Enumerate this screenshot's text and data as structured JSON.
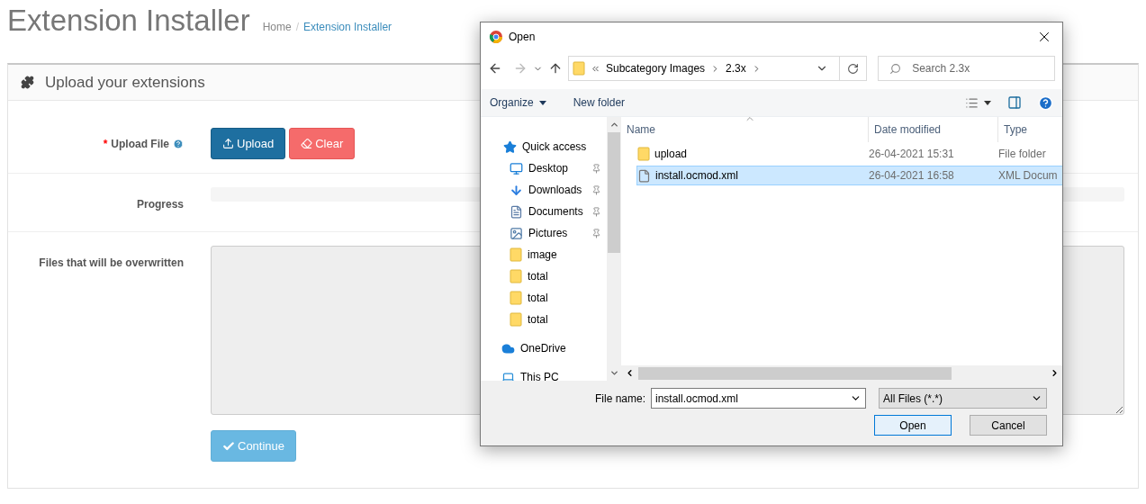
{
  "page": {
    "title": "Extension Installer",
    "separator": "/",
    "breadcrumb": [
      {
        "label": "Home",
        "active": false
      },
      {
        "label": "Extension Installer",
        "active": true
      }
    ]
  },
  "panel": {
    "heading": "Upload your extensions",
    "upload": {
      "label": "Upload File",
      "required_mark": "*",
      "buttons": [
        {
          "label": "Upload",
          "kind": "primary"
        },
        {
          "label": "Clear",
          "kind": "danger"
        }
      ]
    },
    "progress": {
      "label": "Progress",
      "level": 0
    },
    "overwritten": {
      "label": "Files that will be overwritten"
    },
    "continue": {
      "label": "Continue",
      "disabled": true
    }
  },
  "dialog": {
    "title": "Open",
    "address": {
      "path": [
        "Subcategory Images",
        "2.3x"
      ]
    },
    "search": {
      "placeholder": "Search 2.3x"
    },
    "toolbar": [
      {
        "label": "Organize",
        "menu": true
      },
      {
        "label": "New folder",
        "menu": false
      }
    ],
    "nav": [
      {
        "label": "Quick access",
        "kind": "star",
        "children": [
          {
            "label": "Desktop",
            "kind": "desktop",
            "pinned": true
          },
          {
            "label": "Downloads",
            "kind": "downloads",
            "pinned": true
          },
          {
            "label": "Documents",
            "kind": "documents",
            "pinned": true
          },
          {
            "label": "Pictures",
            "kind": "pictures",
            "pinned": true
          },
          {
            "label": "image",
            "kind": "folder",
            "pinned": false
          },
          {
            "label": "total",
            "kind": "folder",
            "pinned": false
          },
          {
            "label": "total",
            "kind": "folder",
            "pinned": false
          },
          {
            "label": "total",
            "kind": "folder",
            "pinned": false
          }
        ]
      },
      {
        "label": "OneDrive",
        "kind": "cloud"
      },
      {
        "label": "This PC",
        "kind": "pc"
      }
    ],
    "columns": [
      "Name",
      "Date modified",
      "Type"
    ],
    "files": [
      {
        "name": "upload",
        "kind": "folder",
        "date": "26-04-2021 15:31",
        "type": "File folder",
        "selected": false
      },
      {
        "name": "install.ocmod.xml",
        "kind": "file",
        "date": "26-04-2021 16:58",
        "type": "XML Docum",
        "selected": true
      }
    ],
    "file_name_label": "File name:",
    "file_name": "install.ocmod.xml",
    "file_type": "All Files (*.*)",
    "buttons": [
      {
        "label": "Open",
        "default": true
      },
      {
        "label": "Cancel",
        "default": false
      }
    ]
  }
}
